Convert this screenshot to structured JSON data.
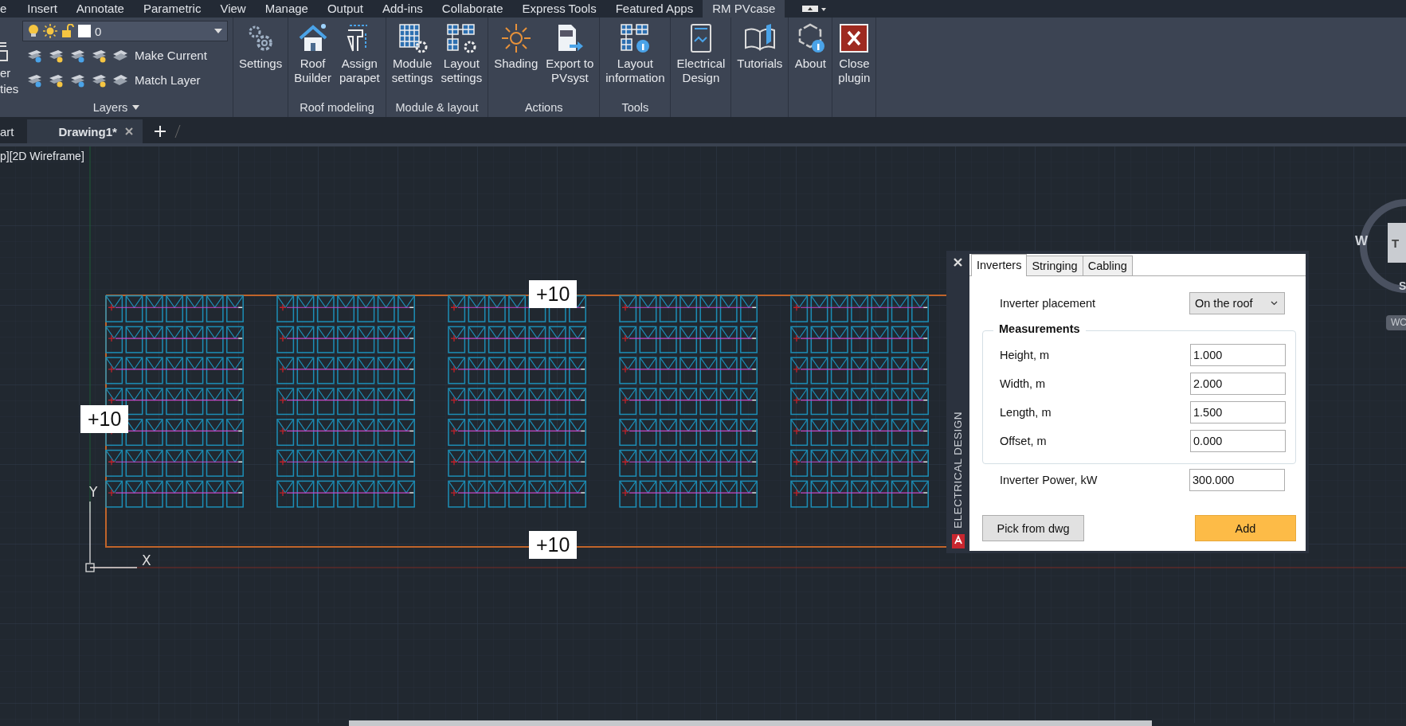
{
  "menu_tabs": [
    {
      "label": "e",
      "selected": false
    },
    {
      "label": "Insert",
      "selected": false
    },
    {
      "label": "Annotate",
      "selected": false
    },
    {
      "label": "Parametric",
      "selected": false
    },
    {
      "label": "View",
      "selected": false
    },
    {
      "label": "Manage",
      "selected": false
    },
    {
      "label": "Output",
      "selected": false
    },
    {
      "label": "Add-ins",
      "selected": false
    },
    {
      "label": "Collaborate",
      "selected": false
    },
    {
      "label": "Express Tools",
      "selected": false
    },
    {
      "label": "Featured Apps",
      "selected": false
    },
    {
      "label": "RM PVcase",
      "selected": true
    }
  ],
  "layers_panel": {
    "cut_button_lines": [
      "er",
      "ties"
    ],
    "layer_value": "0",
    "actions": [
      "Make Current",
      "Match Layer"
    ],
    "title": "Layers"
  },
  "ribbon_panels": [
    {
      "buttons": [
        {
          "label": "Settings",
          "kind": "gears"
        }
      ]
    },
    {
      "title": "Roof modeling",
      "buttons": [
        {
          "label": "Roof\nBuilder",
          "kind": "house"
        },
        {
          "label": "Assign\nparapet",
          "kind": "parapet"
        }
      ]
    },
    {
      "title": "Module & layout",
      "buttons": [
        {
          "label": "Module\nsettings",
          "kind": "module"
        },
        {
          "label": "Layout\nsettings",
          "kind": "layout"
        }
      ]
    },
    {
      "title": "Actions",
      "buttons": [
        {
          "label": "Shading",
          "kind": "sun"
        },
        {
          "label": "Export to\nPVsyst",
          "kind": "export"
        }
      ]
    },
    {
      "title": "Tools",
      "buttons": [
        {
          "label": "Layout\ninformation",
          "kind": "info"
        }
      ]
    },
    {
      "buttons": [
        {
          "label": "Electrical\nDesign",
          "kind": "electrical"
        }
      ]
    },
    {
      "buttons": [
        {
          "label": "Tutorials",
          "kind": "book"
        }
      ]
    },
    {
      "buttons": [
        {
          "label": "About",
          "kind": "about"
        }
      ]
    },
    {
      "buttons": [
        {
          "label": "Close\nplugin",
          "kind": "close"
        }
      ]
    }
  ],
  "doc_tabs": [
    {
      "label": "art",
      "selected": false
    },
    {
      "label": "Drawing1*",
      "selected": true
    }
  ],
  "viewport_label": "p][2D Wireframe]",
  "canvas": {
    "dimension_labels": [
      "+10",
      "+10",
      "+10"
    ],
    "ucs": {
      "x": "X",
      "y": "Y"
    }
  },
  "viewcube": {
    "west": "W",
    "top": "T",
    "south": "S",
    "wcs": "WC"
  },
  "panel": {
    "side_title": "ELECTRICAL DESIGN",
    "tabs": [
      {
        "label": "Inverters",
        "selected": true
      },
      {
        "label": "Stringing",
        "selected": false
      },
      {
        "label": "Cabling",
        "selected": false
      }
    ],
    "placement": {
      "label": "Inverter placement",
      "value": "On the roof"
    },
    "group_title": "Measurements",
    "fields": [
      {
        "label": "Height, m",
        "value": "1.000"
      },
      {
        "label": "Width, m",
        "value": "2.000"
      },
      {
        "label": "Length, m",
        "value": "1.500"
      },
      {
        "label": "Offset, m",
        "value": "0.000"
      }
    ],
    "power": {
      "label": "Inverter Power, kW",
      "value": "300.000"
    },
    "buttons": [
      {
        "label": "Pick from dwg",
        "kind": "secondary"
      },
      {
        "label": "Add",
        "kind": "primary"
      }
    ]
  }
}
